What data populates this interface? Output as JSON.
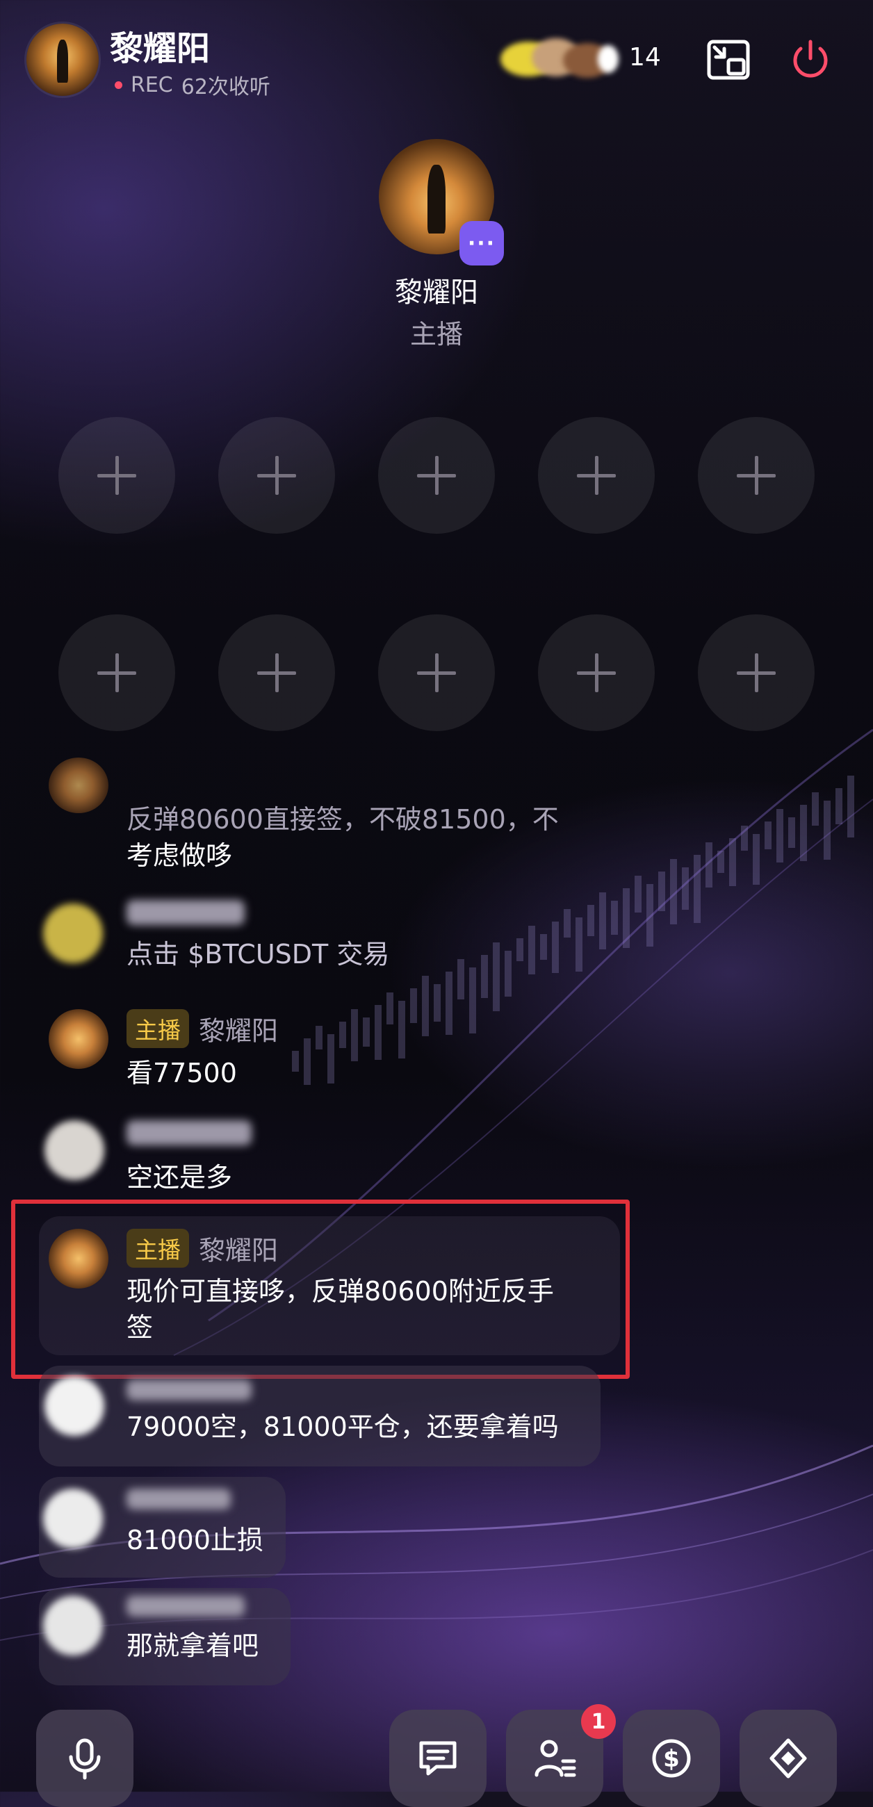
{
  "header": {
    "host_name": "黎耀阳",
    "rec_label": "REC",
    "listen_count": "62次收听",
    "listener_count": "14"
  },
  "host": {
    "name": "黎耀阳",
    "role": "主播"
  },
  "seats": {
    "count": 10
  },
  "chat": [
    {
      "sender": "",
      "is_host": false,
      "text_lines": [
        "反弹80600直接签，不破81500，不",
        "考虑做哆"
      ]
    },
    {
      "sender": "",
      "is_host": false,
      "text_lines": [
        "点击 $BTCUSDT 交易"
      ]
    },
    {
      "sender": "黎耀阳",
      "badge": "主播",
      "is_host": true,
      "text_lines": [
        "看77500"
      ]
    },
    {
      "sender": "",
      "is_host": false,
      "text_lines": [
        "空还是多"
      ]
    },
    {
      "sender": "黎耀阳",
      "badge": "主播",
      "is_host": true,
      "text_lines": [
        "现价可直接哆，反弹80600附近反手",
        "签"
      ]
    },
    {
      "sender": "",
      "is_host": false,
      "text_lines": [
        "79000空，81000平仓，还要拿着吗"
      ]
    },
    {
      "sender": "",
      "is_host": false,
      "text_lines": [
        "81000止损"
      ]
    },
    {
      "sender": "",
      "is_host": false,
      "text_lines": [
        "那就拿着吧"
      ]
    }
  ],
  "bottom_bar": {
    "notification_count": "1"
  },
  "icons": {
    "minimize": "minimize-window-icon",
    "power": "power-icon",
    "more": "more-dots-icon",
    "mic": "microphone-icon",
    "chat": "chat-icon",
    "members": "members-list-icon",
    "tip": "dollar-coin-icon",
    "trade": "diamond-icon"
  },
  "colors": {
    "accent": "#7c5bf0",
    "highlight": "#e0303a",
    "host_badge_text": "#f7c948",
    "rec_dot": "#ff4d6a",
    "power": "#ff4d6a"
  }
}
